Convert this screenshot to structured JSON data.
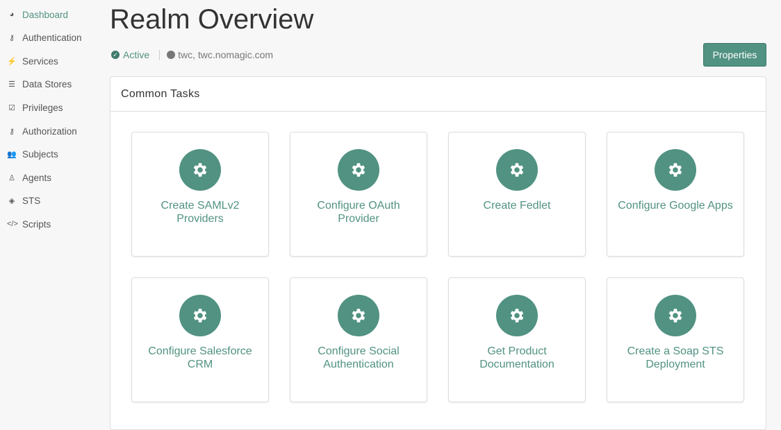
{
  "sidebar": {
    "items": [
      {
        "label": "Dashboard",
        "icon": "dashboard-icon",
        "glyph": "◕"
      },
      {
        "label": "Authentication",
        "icon": "key-icon",
        "glyph": "⚷"
      },
      {
        "label": "Services",
        "icon": "plug-icon",
        "glyph": "⚡"
      },
      {
        "label": "Data Stores",
        "icon": "database-icon",
        "glyph": "☰"
      },
      {
        "label": "Privileges",
        "icon": "check-square-icon",
        "glyph": "☑"
      },
      {
        "label": "Authorization",
        "icon": "key-icon",
        "glyph": "⚷"
      },
      {
        "label": "Subjects",
        "icon": "users-icon",
        "glyph": "👥"
      },
      {
        "label": "Agents",
        "icon": "person-icon",
        "glyph": "♙"
      },
      {
        "label": "STS",
        "icon": "ticket-icon",
        "glyph": "◈"
      },
      {
        "label": "Scripts",
        "icon": "code-icon",
        "glyph": "</>"
      }
    ]
  },
  "header": {
    "title": "Realm Overview",
    "status": "Active",
    "realm": "twc, twc.nomagic.com",
    "properties_label": "Properties"
  },
  "panel": {
    "title": "Common Tasks",
    "tasks": [
      {
        "label": "Create SAMLv2 Providers"
      },
      {
        "label": "Configure OAuth Provider"
      },
      {
        "label": "Create Fedlet"
      },
      {
        "label": "Configure Google Apps"
      },
      {
        "label": "Configure Salesforce CRM"
      },
      {
        "label": "Configure Social Authentication"
      },
      {
        "label": "Get Product Documentation"
      },
      {
        "label": "Create a Soap STS Deployment"
      }
    ]
  },
  "colors": {
    "accent": "#519282"
  }
}
